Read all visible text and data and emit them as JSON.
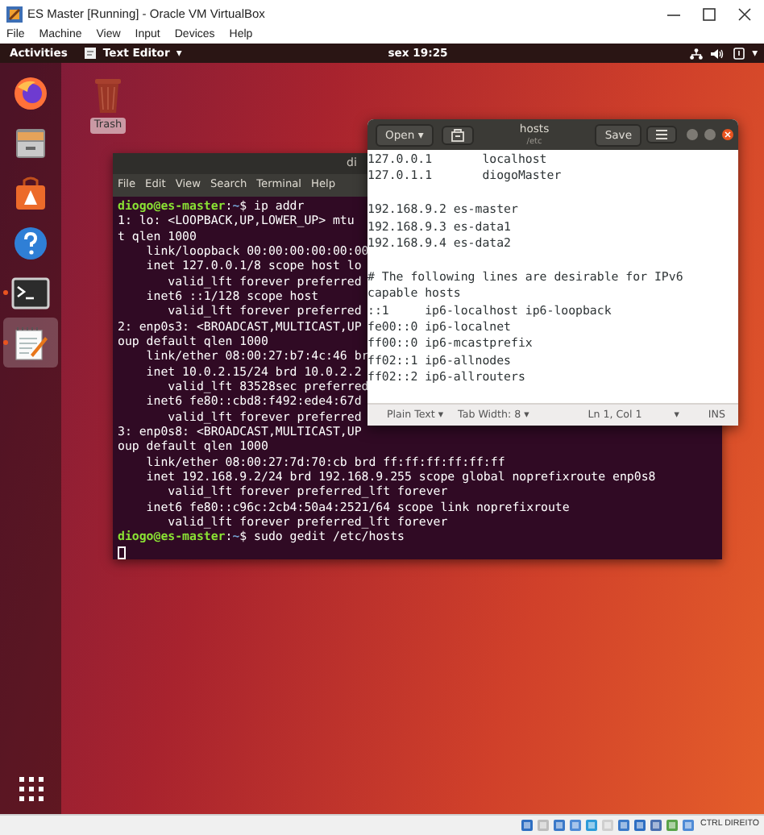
{
  "window": {
    "title": "ES Master [Running] - Oracle VM VirtualBox",
    "menu": [
      "File",
      "Machine",
      "View",
      "Input",
      "Devices",
      "Help"
    ]
  },
  "topbar": {
    "activities": "Activities",
    "app": "Text Editor",
    "app_caret": "▾",
    "clock": "sex 19:25",
    "menu_caret": "▾"
  },
  "dock": [
    {
      "kind": "firefox",
      "running": false,
      "selected": false
    },
    {
      "kind": "files",
      "running": false,
      "selected": false
    },
    {
      "kind": "software",
      "running": false,
      "selected": false
    },
    {
      "kind": "help",
      "running": false,
      "selected": false
    },
    {
      "kind": "terminal",
      "running": true,
      "selected": false
    },
    {
      "kind": "editor",
      "running": true,
      "selected": true
    }
  ],
  "desktop_icons": [
    {
      "label": "Trash",
      "selected": true
    }
  ],
  "terminal": {
    "title": "di",
    "menu": [
      "File",
      "Edit",
      "View",
      "Search",
      "Terminal",
      "Help"
    ],
    "lines": [
      {
        "kind": "prompt",
        "user": "diogo@es-master",
        "sep": ":",
        "path": "~",
        "command": "$ ip addr"
      },
      {
        "kind": "output",
        "text": "1: lo: <LOOPBACK,UP,LOWER_UP> mtu"
      },
      {
        "kind": "output",
        "text": "t qlen 1000"
      },
      {
        "kind": "output",
        "text": "    link/loopback 00:00:00:00:00:00"
      },
      {
        "kind": "output",
        "text": "    inet 127.0.0.1/8 scope host lo"
      },
      {
        "kind": "output",
        "text": "       valid_lft forever preferred"
      },
      {
        "kind": "output",
        "text": "    inet6 ::1/128 scope host"
      },
      {
        "kind": "output",
        "text": "       valid_lft forever preferred"
      },
      {
        "kind": "output",
        "text": "2: enp0s3: <BROADCAST,MULTICAST,UP"
      },
      {
        "kind": "output",
        "text": "oup default qlen 1000"
      },
      {
        "kind": "output",
        "text": "    link/ether 08:00:27:b7:4c:46 br"
      },
      {
        "kind": "output",
        "text": "    inet 10.0.2.15/24 brd 10.0.2.2"
      },
      {
        "kind": "output",
        "text": "       valid_lft 83528sec preferred"
      },
      {
        "kind": "output",
        "text": "    inet6 fe80::cbd8:f492:ede4:67d"
      },
      {
        "kind": "output",
        "text": "       valid_lft forever preferred"
      },
      {
        "kind": "output",
        "text": "3: enp0s8: <BROADCAST,MULTICAST,UP"
      },
      {
        "kind": "output",
        "text": "oup default qlen 1000"
      },
      {
        "kind": "output",
        "text": "    link/ether 08:00:27:7d:70:cb brd ff:ff:ff:ff:ff:ff"
      },
      {
        "kind": "output",
        "text": "    inet 192.168.9.2/24 brd 192.168.9.255 scope global noprefixroute enp0s8"
      },
      {
        "kind": "output",
        "text": "       valid_lft forever preferred_lft forever"
      },
      {
        "kind": "output",
        "text": "    inet6 fe80::c96c:2cb4:50a4:2521/64 scope link noprefixroute"
      },
      {
        "kind": "output",
        "text": "       valid_lft forever preferred_lft forever"
      },
      {
        "kind": "prompt",
        "user": "diogo@es-master",
        "sep": ":",
        "path": "~",
        "command": "$ sudo gedit /etc/hosts"
      },
      {
        "kind": "cursor"
      }
    ]
  },
  "gedit": {
    "open": "Open",
    "open_caret": "▾",
    "title": "hosts",
    "subtitle": "/etc",
    "save": "Save",
    "blocks": [
      [
        "127.0.0.1       localhost",
        "127.0.1.1       diogoMaster"
      ],
      [
        "192.168.9.2 es-master",
        "192.168.9.3 es-data1",
        "192.168.9.4 es-data2"
      ],
      [
        "# The following lines are desirable for IPv6",
        "capable hosts",
        "::1     ip6-localhost ip6-loopback",
        "fe00::0 ip6-localnet",
        "ff00::0 ip6-mcastprefix",
        "ff02::1 ip6-allnodes",
        "ff02::2 ip6-allrouters"
      ]
    ],
    "status": [
      {
        "text": "Plain Text",
        "caret": "▾"
      },
      {
        "text": "Tab Width: 8",
        "caret": "▾"
      },
      {
        "text": "Ln 1, Col 1",
        "caret": "▾"
      },
      {
        "text": "INS"
      }
    ]
  },
  "status_bar": {
    "host_key": "CTRL DIREITO"
  }
}
